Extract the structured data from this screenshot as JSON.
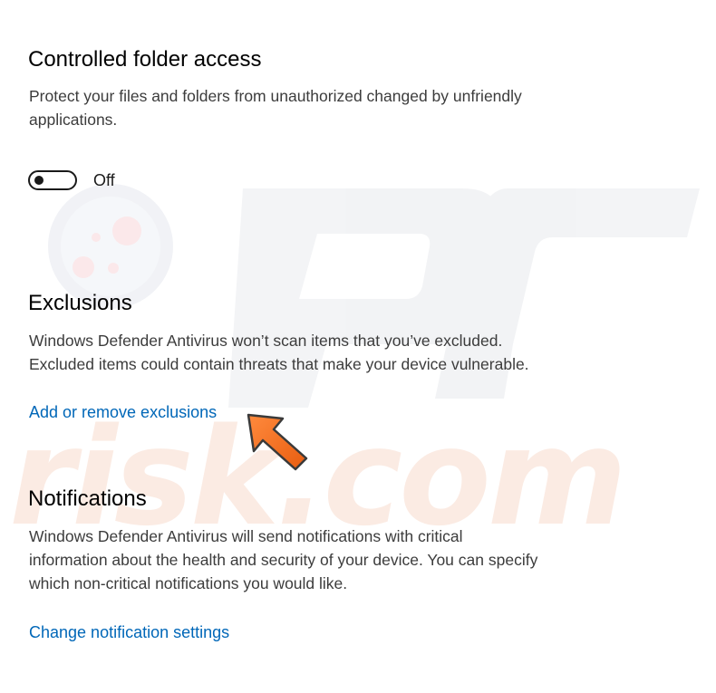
{
  "controlled_folder": {
    "title": "Controlled folder access",
    "description_lines": [
      "Protect your files and folders from unauthorized changed by unfriendly",
      "applications."
    ],
    "toggle_state": "Off"
  },
  "exclusions": {
    "title": "Exclusions",
    "description_lines": [
      "Windows Defender Antivirus won’t scan items that you’ve excluded.",
      "Excluded items could contain threats that make your device vulnerable."
    ],
    "link": "Add or remove exclusions"
  },
  "notifications": {
    "title": "Notifications",
    "description_lines": [
      "Windows Defender Antivirus will send notifications with critical",
      "information about the health and security of your device.  You can specify",
      "which non-critical notifications you would like."
    ],
    "link": "Change notification settings"
  },
  "watermark": {
    "text": "pcrisk.com",
    "icon": "magnifier-logo-icon"
  },
  "annotation": {
    "icon": "orange-pointer-arrow-icon",
    "color": "#f26a1b"
  },
  "colors": {
    "link": "#0067b8",
    "heading": "#000000",
    "body_text": "#3c3c3c"
  }
}
